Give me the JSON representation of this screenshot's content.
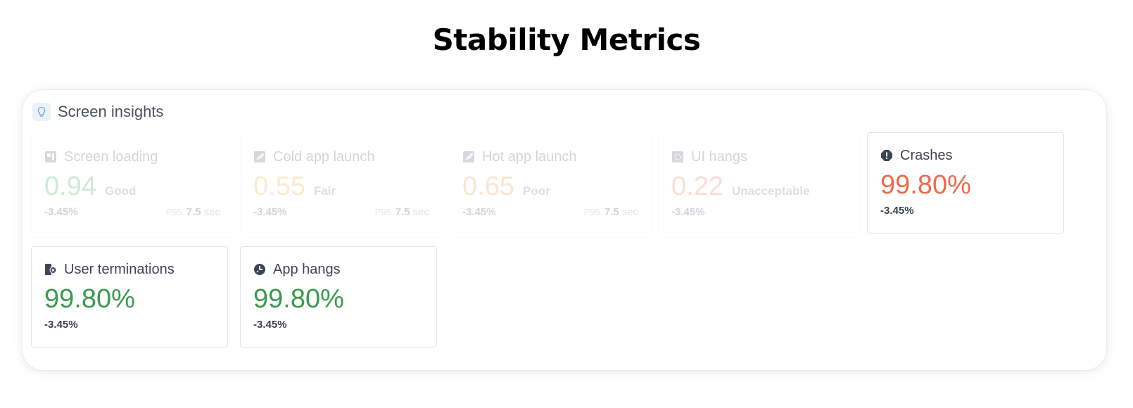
{
  "page": {
    "title": "Stability Metrics"
  },
  "panel": {
    "title": "Screen insights"
  },
  "metrics": [
    {
      "label": "Screen loading",
      "value": "0.94",
      "rating": "Good",
      "delta": "-3.45%",
      "p95_tag": "P95",
      "p95_value": "7.5",
      "p95_unit": "sec",
      "color": "#2e9e4c",
      "icon": "screen-loading-icon",
      "dimmed": true
    },
    {
      "label": "Cold app launch",
      "value": "0.55",
      "rating": "Fair",
      "delta": "-3.45%",
      "p95_tag": "P95",
      "p95_value": "7.5",
      "p95_unit": "sec",
      "color": "#e5a72a",
      "icon": "rocket-icon",
      "dimmed": true
    },
    {
      "label": "Hot app launch",
      "value": "0.65",
      "rating": "Poor",
      "delta": "-3.45%",
      "p95_tag": "P95",
      "p95_value": "7.5",
      "p95_unit": "sec",
      "color": "#ef8a3a",
      "icon": "rocket-icon",
      "dimmed": true
    },
    {
      "label": "UI hangs",
      "value": "0.22",
      "rating": "Unacceptable",
      "delta": "-3.45%",
      "color": "#ef6a4c",
      "icon": "ui-hangs-icon",
      "dimmed": true
    },
    {
      "label": "Crashes",
      "value": "99.80%",
      "delta": "-3.45%",
      "color": "#ef6a4c",
      "icon": "crash-alert-icon",
      "dimmed": false
    },
    {
      "label": "User terminations",
      "value": "99.80%",
      "delta": "-3.45%",
      "color": "#3a9a4f",
      "icon": "user-termination-icon",
      "dimmed": false
    },
    {
      "label": "App hangs",
      "value": "99.80%",
      "delta": "-3.45%",
      "color": "#3a9a4f",
      "icon": "app-hang-icon",
      "dimmed": false
    }
  ]
}
